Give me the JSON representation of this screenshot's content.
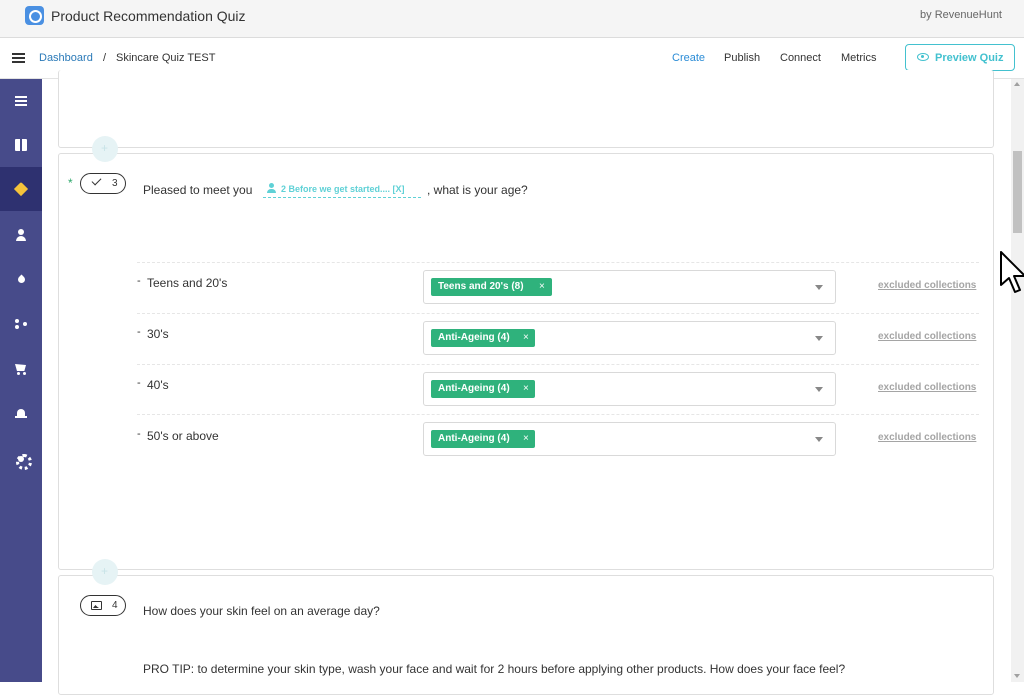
{
  "app": {
    "title": "Product Recommendation Quiz",
    "byline": "by RevenueHunt"
  },
  "breadcrumb": {
    "root": "Dashboard",
    "separator": "/",
    "current": "Skincare Quiz TEST"
  },
  "tabs": [
    {
      "label": "Create",
      "active": true
    },
    {
      "label": "Publish",
      "active": false
    },
    {
      "label": "Connect",
      "active": false
    },
    {
      "label": "Metrics",
      "active": false
    }
  ],
  "preview_button": {
    "label": "Preview Quiz",
    "icon": "eye-icon"
  },
  "sidebar": {
    "items": [
      {
        "icon": "list-icon",
        "active": false
      },
      {
        "icon": "box-icon",
        "active": false
      },
      {
        "icon": "tag-icon",
        "active": true
      },
      {
        "icon": "user-icon",
        "active": false
      },
      {
        "icon": "drop-icon",
        "active": false
      },
      {
        "icon": "flow-icon",
        "active": false
      },
      {
        "icon": "cart-icon",
        "active": false
      },
      {
        "icon": "bell-icon",
        "active": false
      },
      {
        "icon": "gear-icon",
        "active": false
      }
    ]
  },
  "question3": {
    "required_mark": "*",
    "number": "3",
    "type_icon": "check-icon",
    "text_before": "Pleased to meet you",
    "mention": "2 Before we get started.... [X]",
    "text_after": ", what is your age?",
    "options": [
      {
        "dash": "-",
        "label": "Teens and 20's",
        "chip": "Teens and 20's (8)",
        "remove": "×",
        "link": "excluded collections"
      },
      {
        "dash": "-",
        "label": "30's",
        "chip": "Anti-Ageing (4)",
        "remove": "×",
        "link": "excluded collections"
      },
      {
        "dash": "-",
        "label": "40's",
        "chip": "Anti-Ageing (4)",
        "remove": "×",
        "link": "excluded collections"
      },
      {
        "dash": "-",
        "label": "50's or above",
        "chip": "Anti-Ageing (4)",
        "remove": "×",
        "link": "excluded collections"
      }
    ]
  },
  "question4": {
    "number": "4",
    "type_icon": "image-icon",
    "text": "How does your skin feel on an average day?",
    "tip": "PRO TIP: to determine your skin type, wash your face and wait for 2 hours before applying other products. How does your face feel?"
  },
  "colors": {
    "sidebar": "#474b8a",
    "sidebar_active": "#2e3170",
    "accent": "#2b8cd6",
    "teal": "#43c1cf",
    "chip": "#2fb27c"
  }
}
